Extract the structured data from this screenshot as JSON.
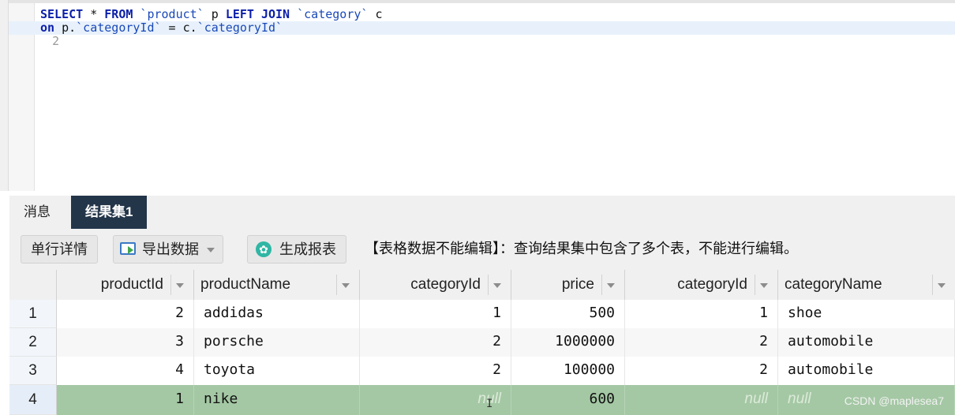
{
  "editor": {
    "lines": [
      {
        "num": "1",
        "text": "SELECT * FROM `product` p LEFT JOIN `category` c"
      },
      {
        "num": "2",
        "text": "on p.`categoryId` = c.`categoryId`"
      }
    ],
    "tokens": {
      "select": "SELECT",
      "star": " * ",
      "from": "FROM",
      "table1": " `product`",
      "alias1": " p ",
      "left_join": "LEFT JOIN",
      "table2": " `category`",
      "alias2": " c",
      "on": "on",
      "lhs": " p.",
      "lhs_col": "`categoryId`",
      "eq": " = c.",
      "rhs_col": "`categoryId`"
    }
  },
  "tabs": [
    {
      "label": "消息",
      "active": false
    },
    {
      "label": "结果集1",
      "active": true
    }
  ],
  "toolbar": {
    "single_row_detail": "单行详情",
    "export_data": "导出数据",
    "generate_report": "生成报表",
    "notice": "【表格数据不能编辑】：查询结果集中包含了多个表，不能进行编辑。"
  },
  "grid": {
    "columns": [
      "productId",
      "productName",
      "categoryId",
      "price",
      "categoryId",
      "categoryName"
    ],
    "rows": [
      {
        "n": "1",
        "productId": "2",
        "productName": "addidas",
        "categoryId": "1",
        "price": "500",
        "categoryId2": "1",
        "categoryName": "shoe"
      },
      {
        "n": "2",
        "productId": "3",
        "productName": "porsche",
        "categoryId": "2",
        "price": "1000000",
        "categoryId2": "2",
        "categoryName": "automobile"
      },
      {
        "n": "3",
        "productId": "4",
        "productName": "toyota",
        "categoryId": "2",
        "price": "100000",
        "categoryId2": "2",
        "categoryName": "automobile"
      },
      {
        "n": "4",
        "productId": "1",
        "productName": "nike",
        "categoryId": "null",
        "price": "600",
        "categoryId2": "null",
        "categoryName": "null"
      }
    ],
    "selected_row": "4"
  },
  "colors": {
    "accent_tab": "#233549",
    "selected_row": "#a4c8a4",
    "keyword": "#0b1ea8"
  },
  "watermark": "CSDN @maplesea7"
}
